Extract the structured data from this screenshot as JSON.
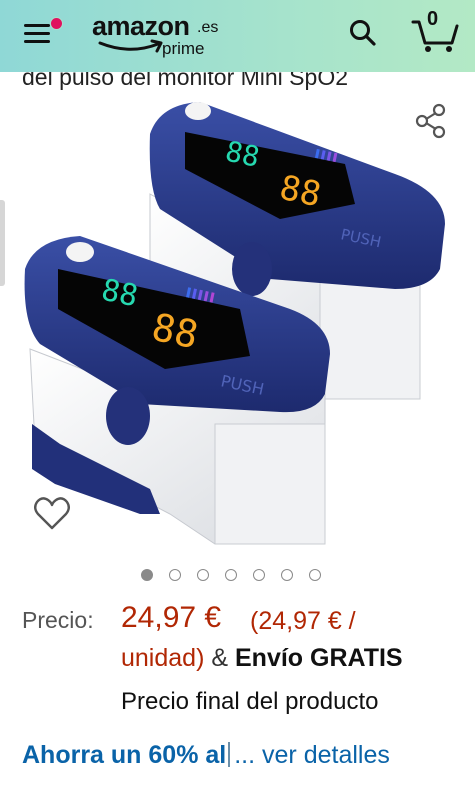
{
  "header": {
    "logo_word": "amazon",
    "logo_tld": ".es",
    "logo_sub": "prime",
    "cart_count": "0",
    "icons": [
      "menu-icon",
      "search-icon",
      "cart-icon"
    ],
    "notification_color": "#e0115f"
  },
  "product": {
    "title_fragment": "del pulso del monitor Mini SpO2",
    "image_description_icons": [
      "share-icon",
      "heart-icon"
    ],
    "carousel": {
      "total": 7,
      "active_index": 0
    }
  },
  "pricing": {
    "label": "Precio:",
    "price": "24,97 €",
    "unit_price_part1": "(24,97 € /",
    "unit_price_part2": "unidad)",
    "amp": "&",
    "shipping": "Envío GRATIS",
    "final_note": "Precio final del producto",
    "savings_text": "Ahorra un 60% al",
    "savings_link": "... ver detalles",
    "price_color": "#b12704",
    "link_color": "#0a63a8"
  }
}
